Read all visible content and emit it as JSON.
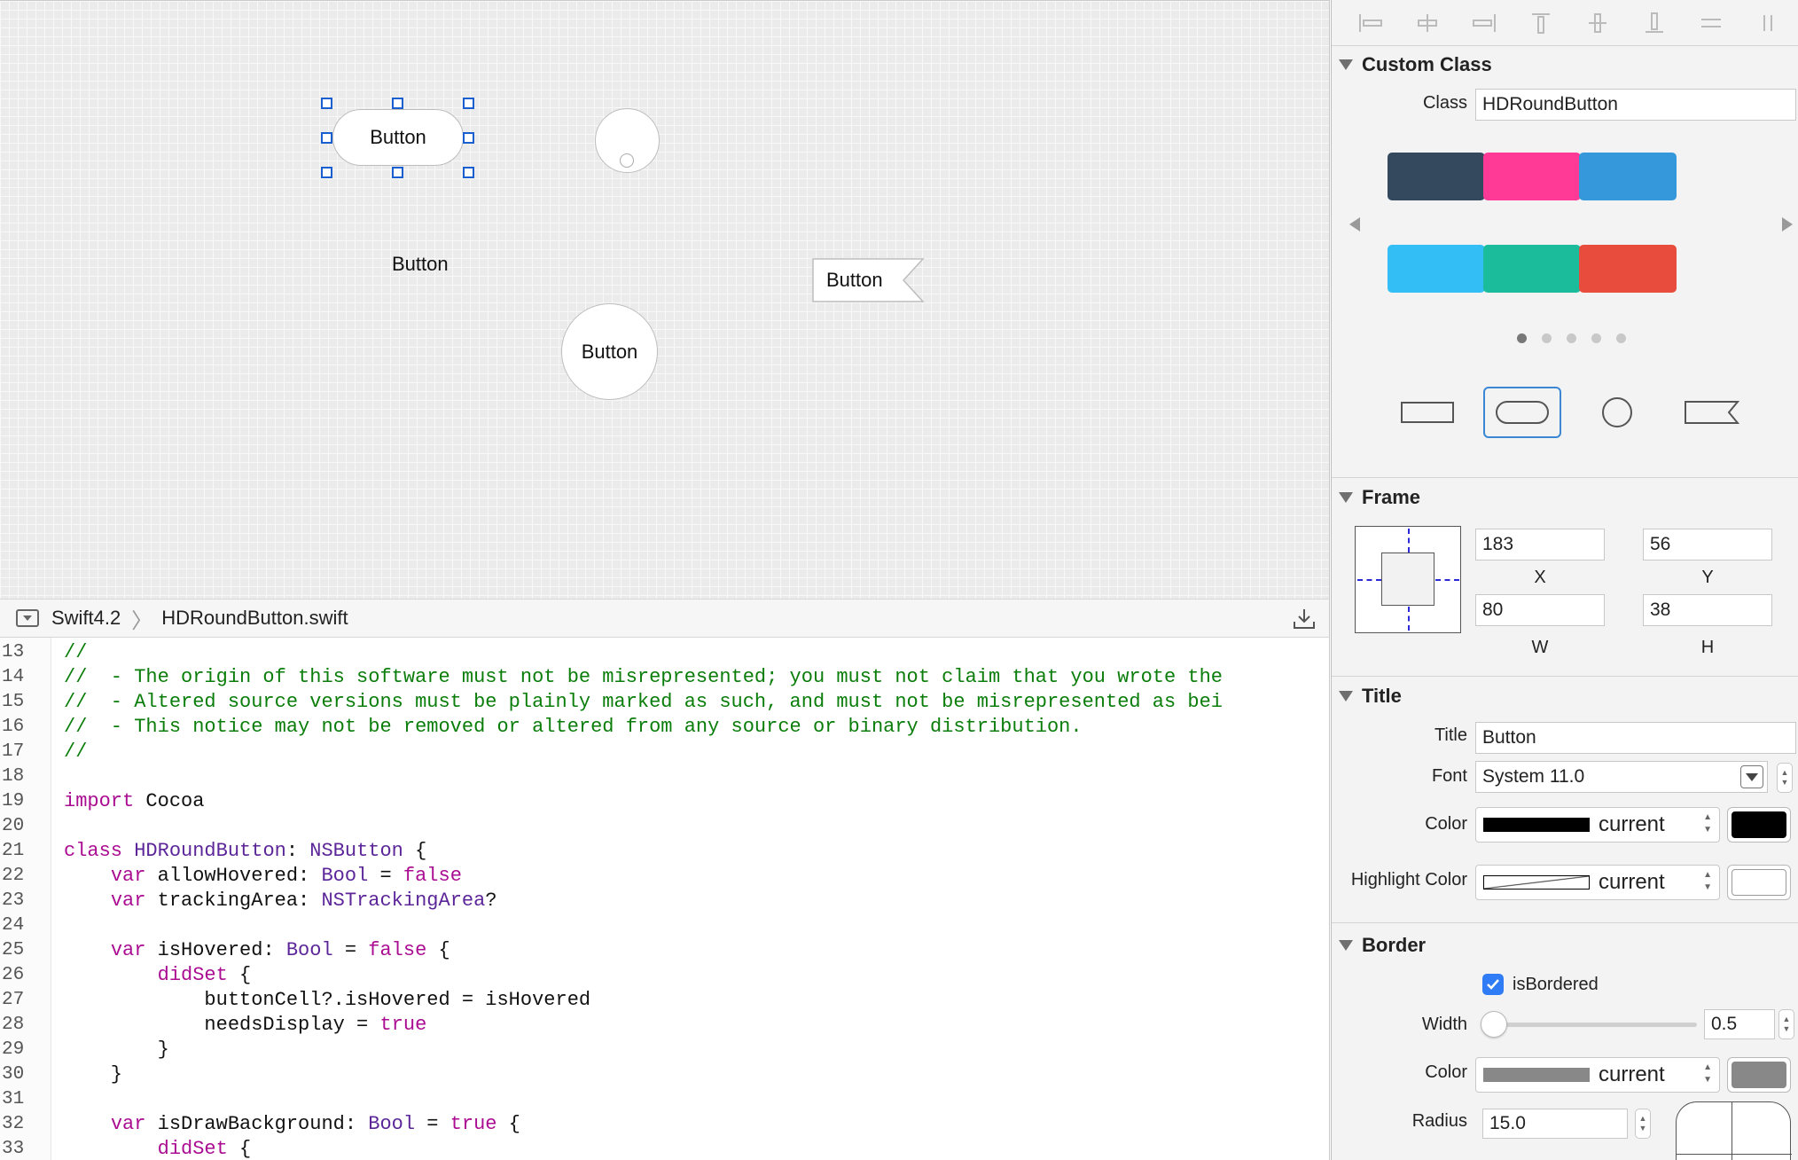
{
  "canvas": {
    "buttons": {
      "selected_capsule": "Button",
      "plain": "Button",
      "circle": "Button",
      "flag": "Button"
    }
  },
  "jumpbar": {
    "project": "Swift4.2",
    "file": "HDRoundButton.swift"
  },
  "editor": {
    "lines": [
      {
        "n": "13",
        "tokens": [
          {
            "t": "comment",
            "v": "//"
          }
        ]
      },
      {
        "n": "14",
        "tokens": [
          {
            "t": "comment",
            "v": "//  - The origin of this software must not be misrepresented; you must not claim that you wrote the"
          }
        ]
      },
      {
        "n": "15",
        "tokens": [
          {
            "t": "comment",
            "v": "//  - Altered source versions must be plainly marked as such, and must not be misrepresented as bei"
          }
        ]
      },
      {
        "n": "16",
        "tokens": [
          {
            "t": "comment",
            "v": "//  - This notice may not be removed or altered from any source or binary distribution."
          }
        ]
      },
      {
        "n": "17",
        "tokens": [
          {
            "t": "comment",
            "v": "//"
          }
        ]
      },
      {
        "n": "18",
        "tokens": []
      },
      {
        "n": "19",
        "tokens": [
          {
            "t": "keyword",
            "v": "import"
          },
          {
            "t": "plain",
            "v": " Cocoa"
          }
        ]
      },
      {
        "n": "20",
        "tokens": []
      },
      {
        "n": "21",
        "tokens": [
          {
            "t": "keyword",
            "v": "class"
          },
          {
            "t": "plain",
            "v": " "
          },
          {
            "t": "type",
            "v": "HDRoundButton"
          },
          {
            "t": "plain",
            "v": ": "
          },
          {
            "t": "type",
            "v": "NSButton"
          },
          {
            "t": "plain",
            "v": " {"
          }
        ]
      },
      {
        "n": "22",
        "tokens": [
          {
            "t": "plain",
            "v": "    "
          },
          {
            "t": "keyword",
            "v": "var"
          },
          {
            "t": "plain",
            "v": " allowHovered: "
          },
          {
            "t": "type",
            "v": "Bool"
          },
          {
            "t": "plain",
            "v": " = "
          },
          {
            "t": "keyword",
            "v": "false"
          }
        ]
      },
      {
        "n": "23",
        "tokens": [
          {
            "t": "plain",
            "v": "    "
          },
          {
            "t": "keyword",
            "v": "var"
          },
          {
            "t": "plain",
            "v": " trackingArea: "
          },
          {
            "t": "type",
            "v": "NSTrackingArea"
          },
          {
            "t": "plain",
            "v": "?"
          }
        ]
      },
      {
        "n": "24",
        "tokens": []
      },
      {
        "n": "25",
        "tokens": [
          {
            "t": "plain",
            "v": "    "
          },
          {
            "t": "keyword",
            "v": "var"
          },
          {
            "t": "plain",
            "v": " isHovered: "
          },
          {
            "t": "type",
            "v": "Bool"
          },
          {
            "t": "plain",
            "v": " = "
          },
          {
            "t": "keyword",
            "v": "false"
          },
          {
            "t": "plain",
            "v": " {"
          }
        ]
      },
      {
        "n": "26",
        "tokens": [
          {
            "t": "plain",
            "v": "        "
          },
          {
            "t": "keyword",
            "v": "didSet"
          },
          {
            "t": "plain",
            "v": " {"
          }
        ]
      },
      {
        "n": "27",
        "tokens": [
          {
            "t": "plain",
            "v": "            buttonCell?.isHovered = isHovered"
          }
        ]
      },
      {
        "n": "28",
        "tokens": [
          {
            "t": "plain",
            "v": "            needsDisplay = "
          },
          {
            "t": "keyword",
            "v": "true"
          }
        ]
      },
      {
        "n": "29",
        "tokens": [
          {
            "t": "plain",
            "v": "        }"
          }
        ]
      },
      {
        "n": "30",
        "tokens": [
          {
            "t": "plain",
            "v": "    }"
          }
        ]
      },
      {
        "n": "31",
        "tokens": []
      },
      {
        "n": "32",
        "tokens": [
          {
            "t": "plain",
            "v": "    "
          },
          {
            "t": "keyword",
            "v": "var"
          },
          {
            "t": "plain",
            "v": " isDrawBackground: "
          },
          {
            "t": "type",
            "v": "Bool"
          },
          {
            "t": "plain",
            "v": " = "
          },
          {
            "t": "keyword",
            "v": "true"
          },
          {
            "t": "plain",
            "v": " {"
          }
        ]
      },
      {
        "n": "33",
        "tokens": [
          {
            "t": "plain",
            "v": "        "
          },
          {
            "t": "keyword",
            "v": "didSet"
          },
          {
            "t": "plain",
            "v": " {"
          }
        ]
      }
    ]
  },
  "inspector": {
    "custom_class": {
      "heading": "Custom Class",
      "class_label": "Class",
      "class_value": "HDRoundButton",
      "swatches": [
        "#34495e",
        "#ff3a96",
        "#3498db",
        "#33bff5",
        "#1abc9c",
        "#e74c3c"
      ],
      "page_count": 5,
      "active_page": 1,
      "shapes": [
        "rectangle",
        "capsule",
        "circle",
        "flag"
      ],
      "selected_shape": "capsule"
    },
    "frame": {
      "heading": "Frame",
      "x": "183",
      "x_label": "X",
      "y": "56",
      "y_label": "Y",
      "w": "80",
      "w_label": "W",
      "h": "38",
      "h_label": "H"
    },
    "title": {
      "heading": "Title",
      "title_label": "Title",
      "title_value": "Button",
      "font_label": "Font",
      "font_value": "System  11.0",
      "color_label": "Color",
      "color_value": "current",
      "color_hex": "#000000",
      "highlight_label": "Highlight Color",
      "highlight_value": "current"
    },
    "border": {
      "heading": "Border",
      "bordered_label": "isBordered",
      "bordered_checked": true,
      "width_label": "Width",
      "width_value": "0.5",
      "color_label": "Color",
      "color_value": "current",
      "color_hex": "#888888",
      "radius_label": "Radius",
      "radius_value": "15.0"
    }
  }
}
